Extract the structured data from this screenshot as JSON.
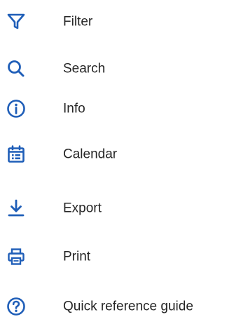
{
  "theme": {
    "icon_color": "#1f5eb8",
    "text_color": "#262626",
    "background": "#ffffff"
  },
  "menu": {
    "items": [
      {
        "label": "Filter",
        "icon": "filter-icon"
      },
      {
        "label": "Search",
        "icon": "search-icon"
      },
      {
        "label": "Info",
        "icon": "info-icon"
      },
      {
        "label": "Calendar",
        "icon": "calendar-icon"
      },
      {
        "label": "Export",
        "icon": "download-icon"
      },
      {
        "label": "Print",
        "icon": "printer-icon"
      },
      {
        "label": "Quick reference guide",
        "icon": "help-circle-icon"
      }
    ]
  }
}
